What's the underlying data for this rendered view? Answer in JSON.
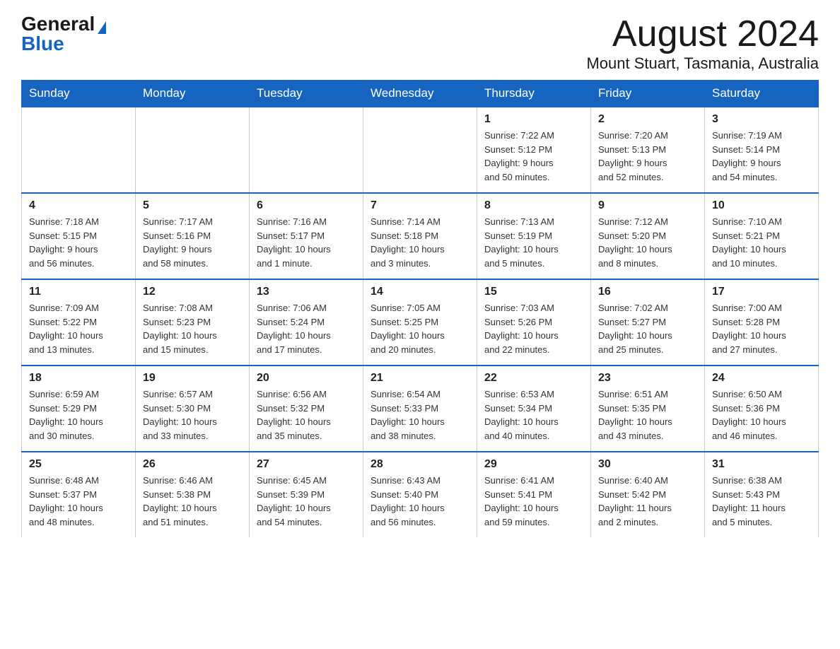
{
  "header": {
    "logo_general": "General",
    "logo_blue": "Blue",
    "title": "August 2024",
    "subtitle": "Mount Stuart, Tasmania, Australia"
  },
  "days_of_week": [
    "Sunday",
    "Monday",
    "Tuesday",
    "Wednesday",
    "Thursday",
    "Friday",
    "Saturday"
  ],
  "weeks": [
    [
      {
        "day": "",
        "info": ""
      },
      {
        "day": "",
        "info": ""
      },
      {
        "day": "",
        "info": ""
      },
      {
        "day": "",
        "info": ""
      },
      {
        "day": "1",
        "info": "Sunrise: 7:22 AM\nSunset: 5:12 PM\nDaylight: 9 hours\nand 50 minutes."
      },
      {
        "day": "2",
        "info": "Sunrise: 7:20 AM\nSunset: 5:13 PM\nDaylight: 9 hours\nand 52 minutes."
      },
      {
        "day": "3",
        "info": "Sunrise: 7:19 AM\nSunset: 5:14 PM\nDaylight: 9 hours\nand 54 minutes."
      }
    ],
    [
      {
        "day": "4",
        "info": "Sunrise: 7:18 AM\nSunset: 5:15 PM\nDaylight: 9 hours\nand 56 minutes."
      },
      {
        "day": "5",
        "info": "Sunrise: 7:17 AM\nSunset: 5:16 PM\nDaylight: 9 hours\nand 58 minutes."
      },
      {
        "day": "6",
        "info": "Sunrise: 7:16 AM\nSunset: 5:17 PM\nDaylight: 10 hours\nand 1 minute."
      },
      {
        "day": "7",
        "info": "Sunrise: 7:14 AM\nSunset: 5:18 PM\nDaylight: 10 hours\nand 3 minutes."
      },
      {
        "day": "8",
        "info": "Sunrise: 7:13 AM\nSunset: 5:19 PM\nDaylight: 10 hours\nand 5 minutes."
      },
      {
        "day": "9",
        "info": "Sunrise: 7:12 AM\nSunset: 5:20 PM\nDaylight: 10 hours\nand 8 minutes."
      },
      {
        "day": "10",
        "info": "Sunrise: 7:10 AM\nSunset: 5:21 PM\nDaylight: 10 hours\nand 10 minutes."
      }
    ],
    [
      {
        "day": "11",
        "info": "Sunrise: 7:09 AM\nSunset: 5:22 PM\nDaylight: 10 hours\nand 13 minutes."
      },
      {
        "day": "12",
        "info": "Sunrise: 7:08 AM\nSunset: 5:23 PM\nDaylight: 10 hours\nand 15 minutes."
      },
      {
        "day": "13",
        "info": "Sunrise: 7:06 AM\nSunset: 5:24 PM\nDaylight: 10 hours\nand 17 minutes."
      },
      {
        "day": "14",
        "info": "Sunrise: 7:05 AM\nSunset: 5:25 PM\nDaylight: 10 hours\nand 20 minutes."
      },
      {
        "day": "15",
        "info": "Sunrise: 7:03 AM\nSunset: 5:26 PM\nDaylight: 10 hours\nand 22 minutes."
      },
      {
        "day": "16",
        "info": "Sunrise: 7:02 AM\nSunset: 5:27 PM\nDaylight: 10 hours\nand 25 minutes."
      },
      {
        "day": "17",
        "info": "Sunrise: 7:00 AM\nSunset: 5:28 PM\nDaylight: 10 hours\nand 27 minutes."
      }
    ],
    [
      {
        "day": "18",
        "info": "Sunrise: 6:59 AM\nSunset: 5:29 PM\nDaylight: 10 hours\nand 30 minutes."
      },
      {
        "day": "19",
        "info": "Sunrise: 6:57 AM\nSunset: 5:30 PM\nDaylight: 10 hours\nand 33 minutes."
      },
      {
        "day": "20",
        "info": "Sunrise: 6:56 AM\nSunset: 5:32 PM\nDaylight: 10 hours\nand 35 minutes."
      },
      {
        "day": "21",
        "info": "Sunrise: 6:54 AM\nSunset: 5:33 PM\nDaylight: 10 hours\nand 38 minutes."
      },
      {
        "day": "22",
        "info": "Sunrise: 6:53 AM\nSunset: 5:34 PM\nDaylight: 10 hours\nand 40 minutes."
      },
      {
        "day": "23",
        "info": "Sunrise: 6:51 AM\nSunset: 5:35 PM\nDaylight: 10 hours\nand 43 minutes."
      },
      {
        "day": "24",
        "info": "Sunrise: 6:50 AM\nSunset: 5:36 PM\nDaylight: 10 hours\nand 46 minutes."
      }
    ],
    [
      {
        "day": "25",
        "info": "Sunrise: 6:48 AM\nSunset: 5:37 PM\nDaylight: 10 hours\nand 48 minutes."
      },
      {
        "day": "26",
        "info": "Sunrise: 6:46 AM\nSunset: 5:38 PM\nDaylight: 10 hours\nand 51 minutes."
      },
      {
        "day": "27",
        "info": "Sunrise: 6:45 AM\nSunset: 5:39 PM\nDaylight: 10 hours\nand 54 minutes."
      },
      {
        "day": "28",
        "info": "Sunrise: 6:43 AM\nSunset: 5:40 PM\nDaylight: 10 hours\nand 56 minutes."
      },
      {
        "day": "29",
        "info": "Sunrise: 6:41 AM\nSunset: 5:41 PM\nDaylight: 10 hours\nand 59 minutes."
      },
      {
        "day": "30",
        "info": "Sunrise: 6:40 AM\nSunset: 5:42 PM\nDaylight: 11 hours\nand 2 minutes."
      },
      {
        "day": "31",
        "info": "Sunrise: 6:38 AM\nSunset: 5:43 PM\nDaylight: 11 hours\nand 5 minutes."
      }
    ]
  ]
}
